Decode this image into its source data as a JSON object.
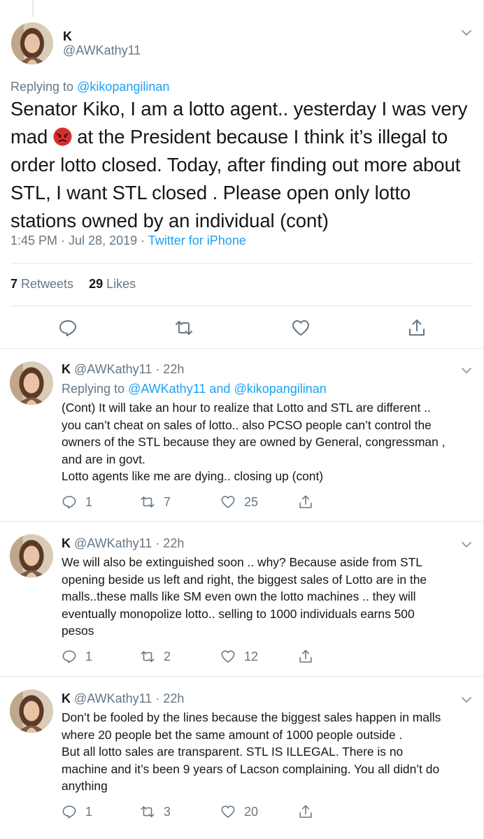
{
  "main_tweet": {
    "name": "K",
    "handle": "@AWKathy11",
    "replying_prefix": "Replying to ",
    "replying_to": "@kikopangilinan",
    "text_before_emoji": "Senator Kiko, I am a lotto agent.. yesterday I was very mad ",
    "emoji": "angry-face-emoji",
    "text_after_emoji": " at the President because I think it’s illegal to order lotto closed. Today, after finding out more about STL, I want STL closed . Please open only lotto stations owned by an individual (cont)",
    "time": "1:45 PM · Jul 28, 2019 · ",
    "source": "Twitter for iPhone",
    "retweets_count": "7",
    "retweets_label": " Retweets",
    "likes_count": "29",
    "likes_label": " Likes",
    "icons": [
      "reply-icon",
      "retweet-icon",
      "like-icon",
      "share-icon"
    ]
  },
  "replies": [
    {
      "name": "K",
      "meta": " @AWKathy11 · 22h",
      "replying_prefix": "Replying to ",
      "replying_to_1": "@AWKathy11",
      "replying_and": " and ",
      "replying_to_2": "@kikopangilinan",
      "text": "(Cont) It will take an hour to realize that Lotto and STL are different ..\nyou can’t cheat on sales of lotto.. also PCSO people can’t control the\nowners of the STL because they are owned by General, congressman ,\nand are in govt.\nLotto agents like me are dying.. closing up (cont)",
      "reply_count": "1",
      "retweet_count": "7",
      "like_count": "25"
    },
    {
      "name": "K",
      "meta": " @AWKathy11 · 22h",
      "text": "We will also be extinguished soon .. why? Because aside from STL\nopening beside us left and right, the biggest sales of Lotto are in the\nmalls..these malls  like SM even own the lotto machines .. they will\neventually monopolize lotto.. selling to 1000 individuals earns 500\npesos",
      "reply_count": "1",
      "retweet_count": "2",
      "like_count": "12"
    },
    {
      "name": "K",
      "meta": " @AWKathy11 · 22h",
      "text": "Don’t be fooled by the lines because the biggest sales happen in malls\nwhere 20 people bet the same amount of 1000 people outside .\nBut all lotto sales are transparent. STL IS ILLEGAL. There is no\nmachine and it’s been 9 years of Lacson complaining. You all didn’t do\nanything",
      "reply_count": "1",
      "retweet_count": "3",
      "like_count": "20"
    }
  ],
  "colors": {
    "link": "#1da1f2",
    "secondary_text": "#657786",
    "primary_text": "#14171a",
    "divider": "#e1e8ed",
    "emoji_red": "#d62d2d"
  }
}
